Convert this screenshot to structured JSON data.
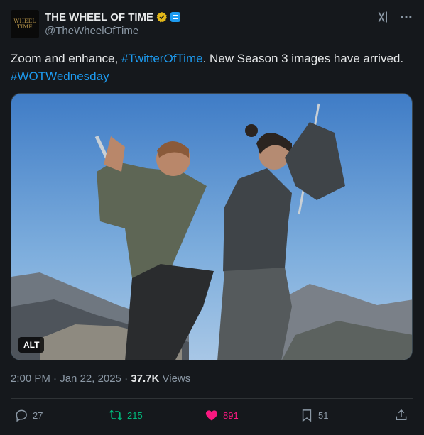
{
  "author": {
    "display_name": "THE WHEEL OF TIME",
    "handle": "@TheWheelOfTime",
    "avatar_text": [
      "WHEEL",
      "TIME"
    ],
    "verified_color": "#e2b719",
    "affiliation_color": "#1d9bf0"
  },
  "tweet": {
    "text_before": "Zoom and enhance, ",
    "hashtag_1": "#TwitterOfTime",
    "text_after": ". New Season 3 images have arrived. ",
    "hashtag_2": "#WOTWednesday"
  },
  "media": {
    "alt_label": "ALT"
  },
  "meta": {
    "time": "2:00 PM",
    "separator": " · ",
    "date": "Jan 22, 2025",
    "views_count": "37.7K",
    "views_label": " Views"
  },
  "actions": {
    "replies": "27",
    "reposts": "215",
    "likes": "891",
    "bookmarks": "51"
  },
  "colors": {
    "background": "#15181c",
    "link": "#1d9bf0",
    "repost": "#00ba7c",
    "like": "#f91880"
  },
  "icons": [
    "verified-badge-icon",
    "affiliation-icon",
    "grok-icon",
    "more-icon",
    "reply-icon",
    "repost-icon",
    "like-icon",
    "bookmark-icon",
    "share-icon"
  ]
}
